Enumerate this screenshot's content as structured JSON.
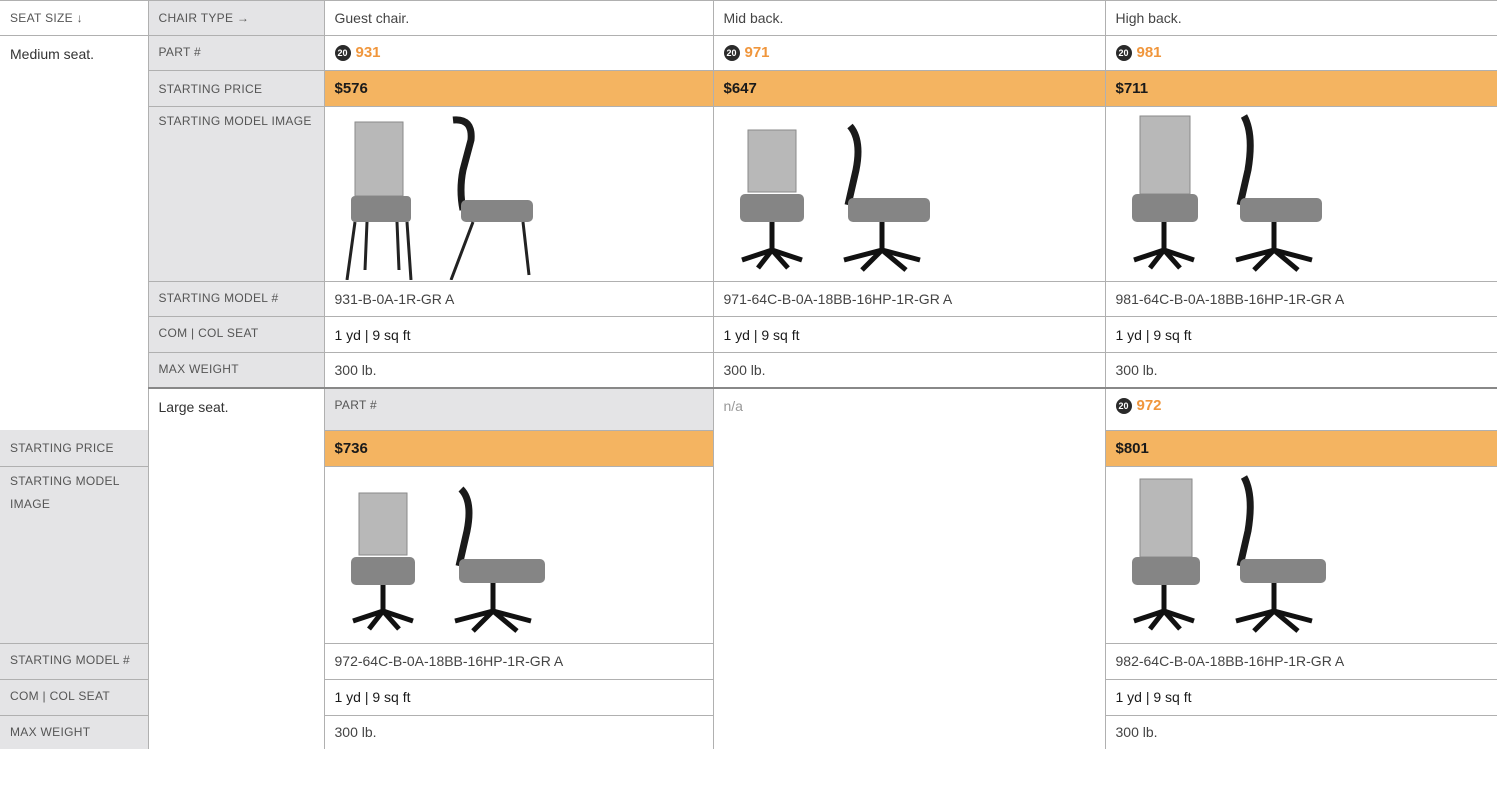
{
  "header": {
    "seat_size": "SEAT SIZE ↓",
    "chair_type": "CHAIR TYPE →",
    "columns": [
      "Guest chair.",
      "Mid back.",
      "High back."
    ]
  },
  "labels": {
    "part": "PART #",
    "price": "STARTING PRICE",
    "image": "STARTING MODEL IMAGE",
    "model": "STARTING MODEL #",
    "com": "COM | COL SEAT",
    "weight": "MAX WEIGHT"
  },
  "badge": "20",
  "medium": {
    "label": "Medium seat.",
    "parts": [
      "931",
      "971",
      "981"
    ],
    "prices": [
      "$576",
      "$647",
      "$711"
    ],
    "models": [
      "931-B-0A-1R-GR A",
      "971-64C-B-0A-18BB-16HP-1R-GR A",
      "981-64C-B-0A-18BB-16HP-1R-GR A"
    ],
    "com": [
      "1 yd | 9 sq ft",
      "1 yd | 9 sq ft",
      "1 yd | 9 sq ft"
    ],
    "weight": [
      "300 lb.",
      "300 lb.",
      "300 lb."
    ]
  },
  "large": {
    "label": "Large seat.",
    "guest_na": "n/a",
    "parts": [
      "972",
      "982"
    ],
    "prices": [
      "$736",
      "$801"
    ],
    "models": [
      "972-64C-B-0A-18BB-16HP-1R-GR A",
      "982-64C-B-0A-18BB-16HP-1R-GR A"
    ],
    "com": [
      "1 yd | 9 sq ft",
      "1 yd | 9 sq ft"
    ],
    "weight": [
      "300 lb.",
      "300 lb."
    ]
  },
  "colors": {
    "price_band": "#f4b461",
    "part_number": "#f0963c",
    "label_bg": "#e4e4e6"
  }
}
